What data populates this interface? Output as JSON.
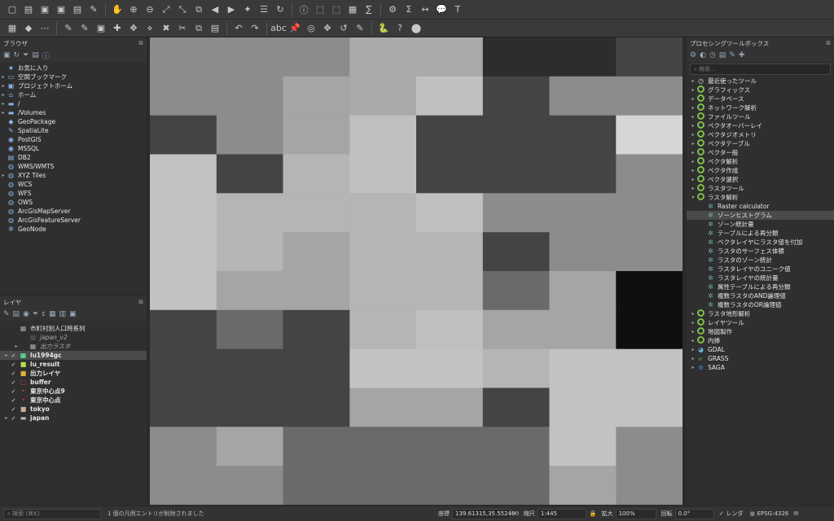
{
  "toolbar1_icons": [
    "new-project",
    "open-project",
    "save-project",
    "save-as",
    "print-layout",
    "style-manager",
    "pan",
    "zoom-in",
    "zoom-out",
    "zoom-full",
    "zoom-layer",
    "zoom-selection",
    "zoom-last",
    "zoom-next",
    "new-bookmark",
    "show-bookmarks",
    "refresh",
    "identify",
    "select",
    "deselect",
    "attribute-table",
    "statistics",
    "processing-toolbox",
    "field-calc",
    "measure",
    "map-tips",
    "text-annotation"
  ],
  "toolbar2_icons": [
    "data-source-manager",
    "new-layer",
    "virtual-layer",
    "digitize",
    "toggle-edit",
    "save-edits",
    "add-feature",
    "move-feature",
    "node-tool",
    "delete",
    "cut",
    "copy",
    "paste",
    "undo",
    "redo",
    "label-tool",
    "pin-labels",
    "show-labels",
    "move-label",
    "rotate-label",
    "change-label",
    "python",
    "help",
    "plugins"
  ],
  "browser": {
    "title": "ブラウザ",
    "items": [
      {
        "label": "お気に入り",
        "icon": "★",
        "arrow": ""
      },
      {
        "label": "空間ブックマーク",
        "icon": "▭",
        "arrow": "▸"
      },
      {
        "label": "プロジェクトホーム",
        "icon": "▣",
        "arrow": "▸"
      },
      {
        "label": "ホーム",
        "icon": "⌂",
        "arrow": "▸"
      },
      {
        "label": "/",
        "icon": "▬",
        "arrow": "▸"
      },
      {
        "label": "/Volumes",
        "icon": "▬",
        "arrow": "▸"
      },
      {
        "label": "GeoPackage",
        "icon": "◆",
        "arrow": ""
      },
      {
        "label": "SpatiaLite",
        "icon": "✎",
        "arrow": ""
      },
      {
        "label": "PostGIS",
        "icon": "◉",
        "arrow": ""
      },
      {
        "label": "MSSQL",
        "icon": "◉",
        "arrow": ""
      },
      {
        "label": "DB2",
        "icon": "▤",
        "arrow": ""
      },
      {
        "label": "WMS/WMTS",
        "icon": "◍",
        "arrow": ""
      },
      {
        "label": "XYZ Tiles",
        "icon": "◍",
        "arrow": "▸"
      },
      {
        "label": "WCS",
        "icon": "◍",
        "arrow": ""
      },
      {
        "label": "WFS",
        "icon": "◍",
        "arrow": ""
      },
      {
        "label": "OWS",
        "icon": "◍",
        "arrow": ""
      },
      {
        "label": "ArcGisMapServer",
        "icon": "◍",
        "arrow": ""
      },
      {
        "label": "ArcGisFeatureServer",
        "icon": "◍",
        "arrow": ""
      },
      {
        "label": "GeoNode",
        "icon": "✲",
        "arrow": ""
      }
    ]
  },
  "layers": {
    "title": "レイヤ",
    "items": [
      {
        "label": "市町村別人口時系列",
        "check": "",
        "arrow": "",
        "icon": "▦",
        "italic": false,
        "bold": false,
        "selected": false,
        "indent": 0
      },
      {
        "label": "japan_v2",
        "check": "",
        "arrow": "",
        "icon": "▩",
        "italic": true,
        "bold": false,
        "selected": false,
        "indent": 1
      },
      {
        "label": "出力ラスタ",
        "check": "",
        "arrow": "▸",
        "icon": "▦",
        "italic": true,
        "bold": false,
        "selected": false,
        "indent": 1
      },
      {
        "label": "lu1994gc",
        "check": "✓",
        "arrow": "▸",
        "icon": "▦",
        "italic": false,
        "bold": true,
        "selected": true,
        "indent": 0
      },
      {
        "label": "lu_result",
        "check": "✓",
        "arrow": "",
        "icon": "■",
        "italic": false,
        "bold": true,
        "selected": false,
        "indent": 0
      },
      {
        "label": "出力レイヤ",
        "check": "✓",
        "arrow": "",
        "icon": "■",
        "italic": false,
        "bold": true,
        "selected": false,
        "indent": 0
      },
      {
        "label": "buffer",
        "check": "✓",
        "arrow": "",
        "icon": "□",
        "italic": false,
        "bold": true,
        "selected": false,
        "indent": 0
      },
      {
        "label": "東京中心点9",
        "check": "✓",
        "arrow": "",
        "icon": "•",
        "italic": false,
        "bold": true,
        "selected": false,
        "indent": 0
      },
      {
        "label": "東京中心点",
        "check": "✓",
        "arrow": "",
        "icon": "•",
        "italic": false,
        "bold": true,
        "selected": false,
        "indent": 0
      },
      {
        "label": "tokyo",
        "check": "✓",
        "arrow": "",
        "icon": "■",
        "italic": false,
        "bold": true,
        "selected": false,
        "indent": 0
      },
      {
        "label": "japan",
        "check": "✓",
        "arrow": "▸",
        "icon": "▬",
        "italic": false,
        "bold": true,
        "selected": false,
        "indent": 0
      }
    ]
  },
  "processing": {
    "title": "プロセシングツールボックス",
    "search_placeholder": "検索...",
    "groups": [
      {
        "label": "最近使ったツール",
        "arrow": "▸",
        "icon": "clock"
      },
      {
        "label": "グラフィックス",
        "arrow": "▸",
        "icon": "q"
      },
      {
        "label": "データベース",
        "arrow": "▸",
        "icon": "q"
      },
      {
        "label": "ネットワーク解析",
        "arrow": "▸",
        "icon": "q"
      },
      {
        "label": "ファイルツール",
        "arrow": "▸",
        "icon": "q"
      },
      {
        "label": "ベクタオーバーレイ",
        "arrow": "▸",
        "icon": "q"
      },
      {
        "label": "ベクタジオメトリ",
        "arrow": "▸",
        "icon": "q"
      },
      {
        "label": "ベクタテーブル",
        "arrow": "▸",
        "icon": "q"
      },
      {
        "label": "ベクター般",
        "arrow": "▸",
        "icon": "q"
      },
      {
        "label": "ベクタ解析",
        "arrow": "▸",
        "icon": "q"
      },
      {
        "label": "ベクタ作成",
        "arrow": "▸",
        "icon": "q"
      },
      {
        "label": "ベクタ選択",
        "arrow": "▸",
        "icon": "q"
      },
      {
        "label": "ラスタツール",
        "arrow": "▸",
        "icon": "q"
      },
      {
        "label": "ラスタ解析",
        "arrow": "▾",
        "icon": "q"
      }
    ],
    "raster_tools": [
      {
        "label": "Raster calculator",
        "selected": false
      },
      {
        "label": "ゾーンヒストグラム",
        "selected": true
      },
      {
        "label": "ゾーン統計量",
        "selected": false
      },
      {
        "label": "テーブルによる再分類",
        "selected": false
      },
      {
        "label": "ベクタレイヤにラスタ値を付加",
        "selected": false
      },
      {
        "label": "ラスタのサーフェス体積",
        "selected": false
      },
      {
        "label": "ラスタのゾーン統計",
        "selected": false
      },
      {
        "label": "ラスタレイヤのユニーク値",
        "selected": false
      },
      {
        "label": "ラスタレイヤの統計量",
        "selected": false
      },
      {
        "label": "属性テーブルによる再分類",
        "selected": false
      },
      {
        "label": "複数ラスタのAND論理値",
        "selected": false
      },
      {
        "label": "複数ラスタのOR論理値",
        "selected": false
      }
    ],
    "groups_after": [
      {
        "label": "ラスタ地形解析",
        "arrow": "▸",
        "icon": "q"
      },
      {
        "label": "レイヤツール",
        "arrow": "▸",
        "icon": "q"
      },
      {
        "label": "地図製作",
        "arrow": "▸",
        "icon": "q"
      },
      {
        "label": "内挿",
        "arrow": "▸",
        "icon": "q"
      },
      {
        "label": "GDAL",
        "arrow": "▸",
        "icon": "gdal"
      },
      {
        "label": "GRASS",
        "arrow": "▸",
        "icon": "grass"
      },
      {
        "label": "SAGA",
        "arrow": "▸",
        "icon": "saga"
      }
    ]
  },
  "statusbar": {
    "search_placeholder": "検索 (⌘K)",
    "message": "1 個の凡例エントリが削除されました",
    "coord_label": "座標",
    "coord_value": "139.61315,35.55246",
    "scale_label": "縮尺",
    "scale_value": "1:445",
    "magnify_label": "拡大",
    "magnify_value": "100%",
    "rotation_label": "回転",
    "rotation_value": "0.0°",
    "render_label": "レンダ",
    "crs_label": "EPSG:4326"
  },
  "raster_grid": [
    [
      "#8c8c8c",
      "#8c8c8c",
      "#8c8c8c",
      "#aaaaaa",
      "#aaaaaa",
      "#2d2d2d",
      "#2d2d2d",
      "#444444"
    ],
    [
      "#8c8c8c",
      "#8c8c8c",
      "#a5a5a5",
      "#aaaaaa",
      "#c0c0c0",
      "#444444",
      "#8c8c8c",
      "#8c8c8c"
    ],
    [
      "#444444",
      "#8c8c8c",
      "#a5a5a5",
      "#c0c0c0",
      "#444444",
      "#444444",
      "#444444",
      "#d5d5d5"
    ],
    [
      "#c2c2c2",
      "#444444",
      "#b5b5b5",
      "#c0c0c0",
      "#444444",
      "#444444",
      "#444444",
      "#8c8c8c"
    ],
    [
      "#c2c2c2",
      "#b5b5b5",
      "#b5b5b5",
      "#b5b5b5",
      "#c0c0c0",
      "#8c8c8c",
      "#8c8c8c",
      "#8c8c8c"
    ],
    [
      "#c2c2c2",
      "#b5b5b5",
      "#a5a5a5",
      "#b5b5b5",
      "#b5b5b5",
      "#444444",
      "#8c8c8c",
      "#8c8c8c"
    ],
    [
      "#c2c2c2",
      "#a5a5a5",
      "#a5a5a5",
      "#b5b5b5",
      "#b5b5b5",
      "#6a6a6a",
      "#a5a5a5",
      "#0f0f0f"
    ],
    [
      "#444444",
      "#6a6a6a",
      "#444444",
      "#b5b5b5",
      "#c0c0c0",
      "#a5a5a5",
      "#a5a5a5",
      "#0f0f0f"
    ],
    [
      "#444444",
      "#444444",
      "#444444",
      "#c2c2c2",
      "#c2c2c2",
      "#b5b5b5",
      "#c2c2c2",
      "#c2c2c2"
    ],
    [
      "#444444",
      "#444444",
      "#444444",
      "#a5a5a5",
      "#a5a5a5",
      "#444444",
      "#c2c2c2",
      "#c2c2c2"
    ],
    [
      "#8c8c8c",
      "#a5a5a5",
      "#6a6a6a",
      "#6a6a6a",
      "#6a6a6a",
      "#6a6a6a",
      "#c2c2c2",
      "#8c8c8c"
    ],
    [
      "#8c8c8c",
      "#8c8c8c",
      "#6a6a6a",
      "#6a6a6a",
      "#6a6a6a",
      "#6a6a6a",
      "#a5a5a5",
      "#8c8c8c"
    ]
  ]
}
